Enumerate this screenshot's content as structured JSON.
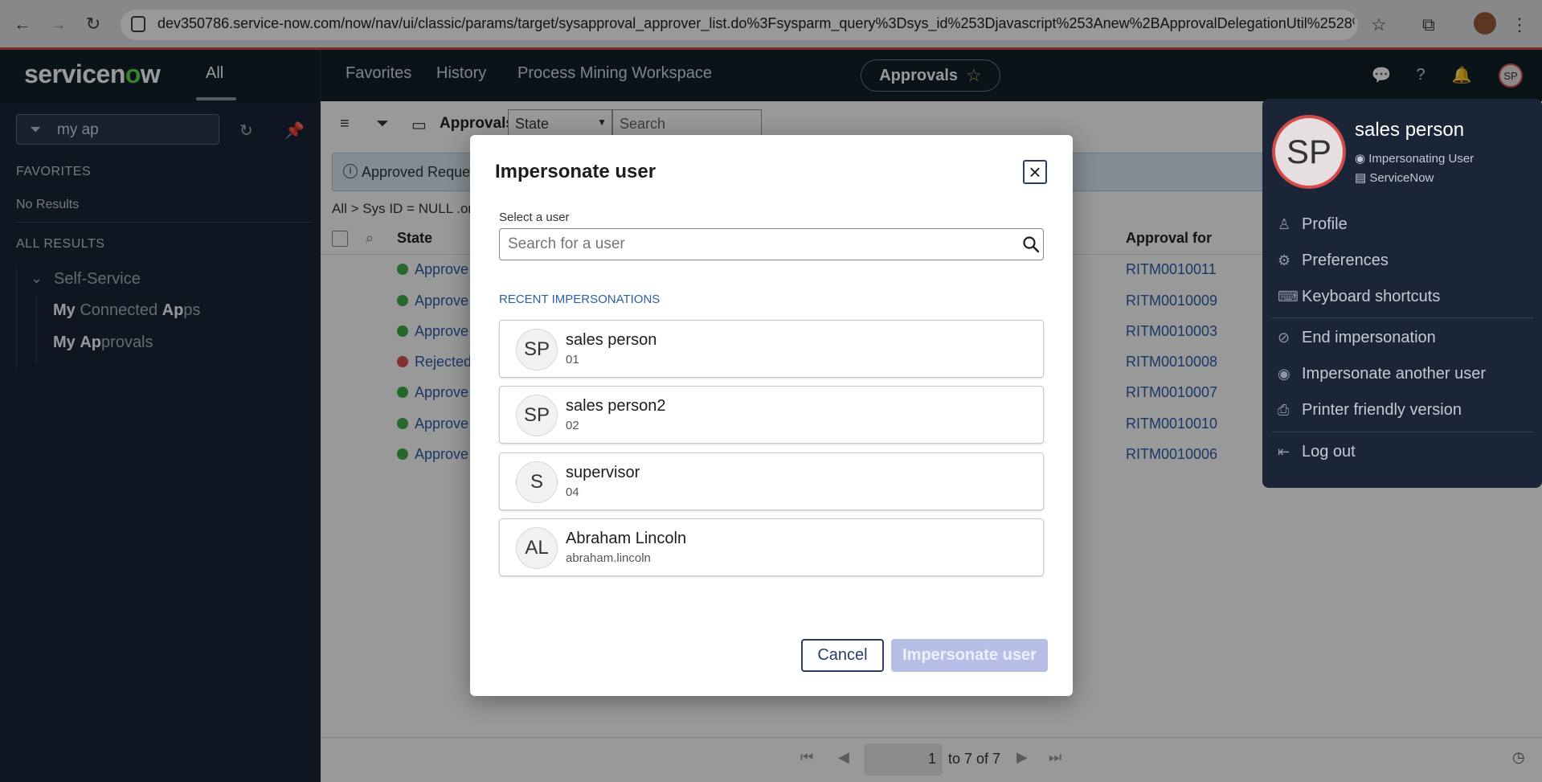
{
  "browser": {
    "url": "dev350786.service-now.com/now/nav/ui/classic/params/target/sysapproval_approver_list.do%3Fsysparm_query%3Dsys_id%253Djavascript%253Anew%2BApprovalDelegationUtil%2528%2529...."
  },
  "header": {
    "logo": "servicenow",
    "all_tab": "All",
    "nav_links": [
      "Favorites",
      "History",
      "Process Mining Workspace"
    ],
    "context_pill": "Approvals",
    "avatar_initials": "SP"
  },
  "leftnav": {
    "filter_value": "my ap",
    "favorites_heading": "FAVORITES",
    "favorites_empty": "No Results",
    "all_results_heading": "ALL RESULTS",
    "group": "Self-Service",
    "items": [
      {
        "bold": "My",
        "rest_a": " Connected ",
        "bold2": "Ap",
        "rest_b": "ps"
      },
      {
        "bold": "My",
        "rest_a": " ",
        "bold2": "Ap",
        "rest_b": "provals"
      }
    ]
  },
  "list": {
    "title": "Approvals",
    "state_select": "State",
    "search_placeholder": "Search",
    "info": "Approved Reques",
    "breadcrumb": "All > Sys ID = NULL .or",
    "col_state": "State",
    "col_approval_for": "Approval for",
    "rows": [
      {
        "state": "Approve",
        "status": "approved",
        "rit": "RITM0010011"
      },
      {
        "state": "Approve",
        "status": "approved",
        "rit": "RITM0010009"
      },
      {
        "state": "Approve",
        "status": "approved",
        "rit": "RITM0010003"
      },
      {
        "state": "Rejected",
        "status": "rejected",
        "rit": "RITM0010008"
      },
      {
        "state": "Approve",
        "status": "approved",
        "rit": "RITM0010007"
      },
      {
        "state": "Approve",
        "status": "approved",
        "rit": "RITM0010010"
      },
      {
        "state": "Approve",
        "status": "approved",
        "rit": "RITM0010006"
      }
    ],
    "pager_page": "1",
    "pager_text": "to 7 of 7"
  },
  "user_menu": {
    "initials": "SP",
    "name": "sales person",
    "status": "Impersonating User",
    "company": "ServiceNow",
    "items": [
      "Profile",
      "Preferences",
      "Keyboard shortcuts",
      "End impersonation",
      "Impersonate another user",
      "Printer friendly version",
      "Log out"
    ]
  },
  "modal": {
    "title": "Impersonate user",
    "select_label": "Select a user",
    "search_placeholder": "Search for a user",
    "recent_heading": "RECENT IMPERSONATIONS",
    "recent": [
      {
        "initials": "SP",
        "name": "sales person",
        "sub": "01"
      },
      {
        "initials": "SP",
        "name": "sales person2",
        "sub": "02"
      },
      {
        "initials": "S",
        "name": "supervisor",
        "sub": "04"
      },
      {
        "initials": "AL",
        "name": "Abraham Lincoln",
        "sub": "abraham.lincoln"
      }
    ],
    "cancel_label": "Cancel",
    "submit_label": "Impersonate user"
  },
  "colors": {
    "approved": "#3fae49",
    "rejected": "#d9534f",
    "link": "#2c5ea8",
    "nav_bg": "#1b2538",
    "header_bg": "#0f2028"
  }
}
